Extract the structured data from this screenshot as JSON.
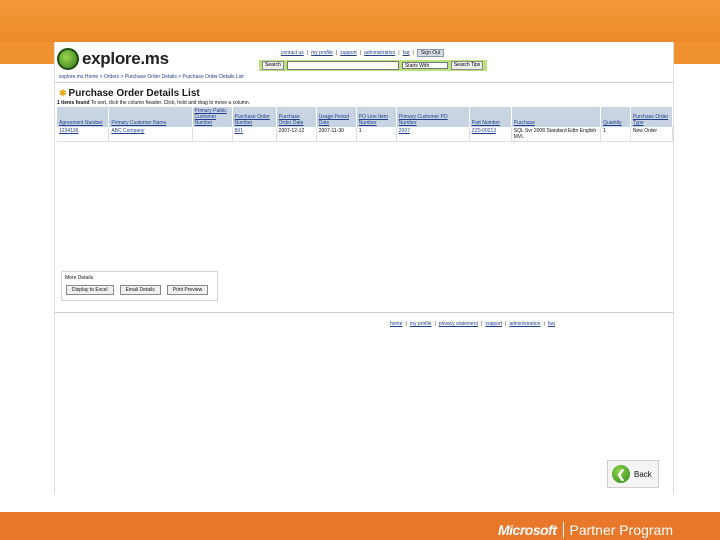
{
  "header": {
    "logo_text": "explore.ms",
    "links": [
      "contact us",
      "my profile",
      "support",
      "administration",
      "faq"
    ],
    "signout_label": "Sign Out"
  },
  "search": {
    "button_label": "Search",
    "match_mode": "Starts With",
    "tips_label": "Search Tips"
  },
  "breadcrumb": "explore.ms Home > Orders > Purchase Order Details > Purchase Order Details List",
  "page_title": "Purchase Order Details List",
  "found_text": {
    "count": "1 items found",
    "hint": "To sort, click the column header. Click, hold and drag to move a column."
  },
  "table": {
    "headers": [
      "Agreement Number",
      "Primary Customer Name",
      "Primary Public Customer Number",
      "Purchase Order Number",
      "Purchase Order Date",
      "Usage Period Date",
      "PO Line Item Number",
      "Primary Customer PO Number",
      "Part Number",
      "Purchase",
      "Quantity",
      "Purchase Order Type"
    ],
    "rows": [
      [
        "1234136",
        "ABC Company",
        "",
        "891",
        "2007-12-12",
        "2007-11-30",
        "1",
        "2007",
        "ZZ0-00213",
        "SQL Svr 2008 Standard Edtn English MVL",
        "1",
        "New Order"
      ]
    ]
  },
  "more_details": {
    "label": "More Details",
    "buttons": [
      "Display to Excel",
      "Email Details",
      "Print Preview"
    ]
  },
  "footer_links": [
    "home",
    "my profile",
    "privacy statement",
    "support",
    "administration",
    "faq"
  ],
  "back_label": "Back",
  "brand": {
    "microsoft": "Microsoft",
    "program": "Partner Program"
  }
}
